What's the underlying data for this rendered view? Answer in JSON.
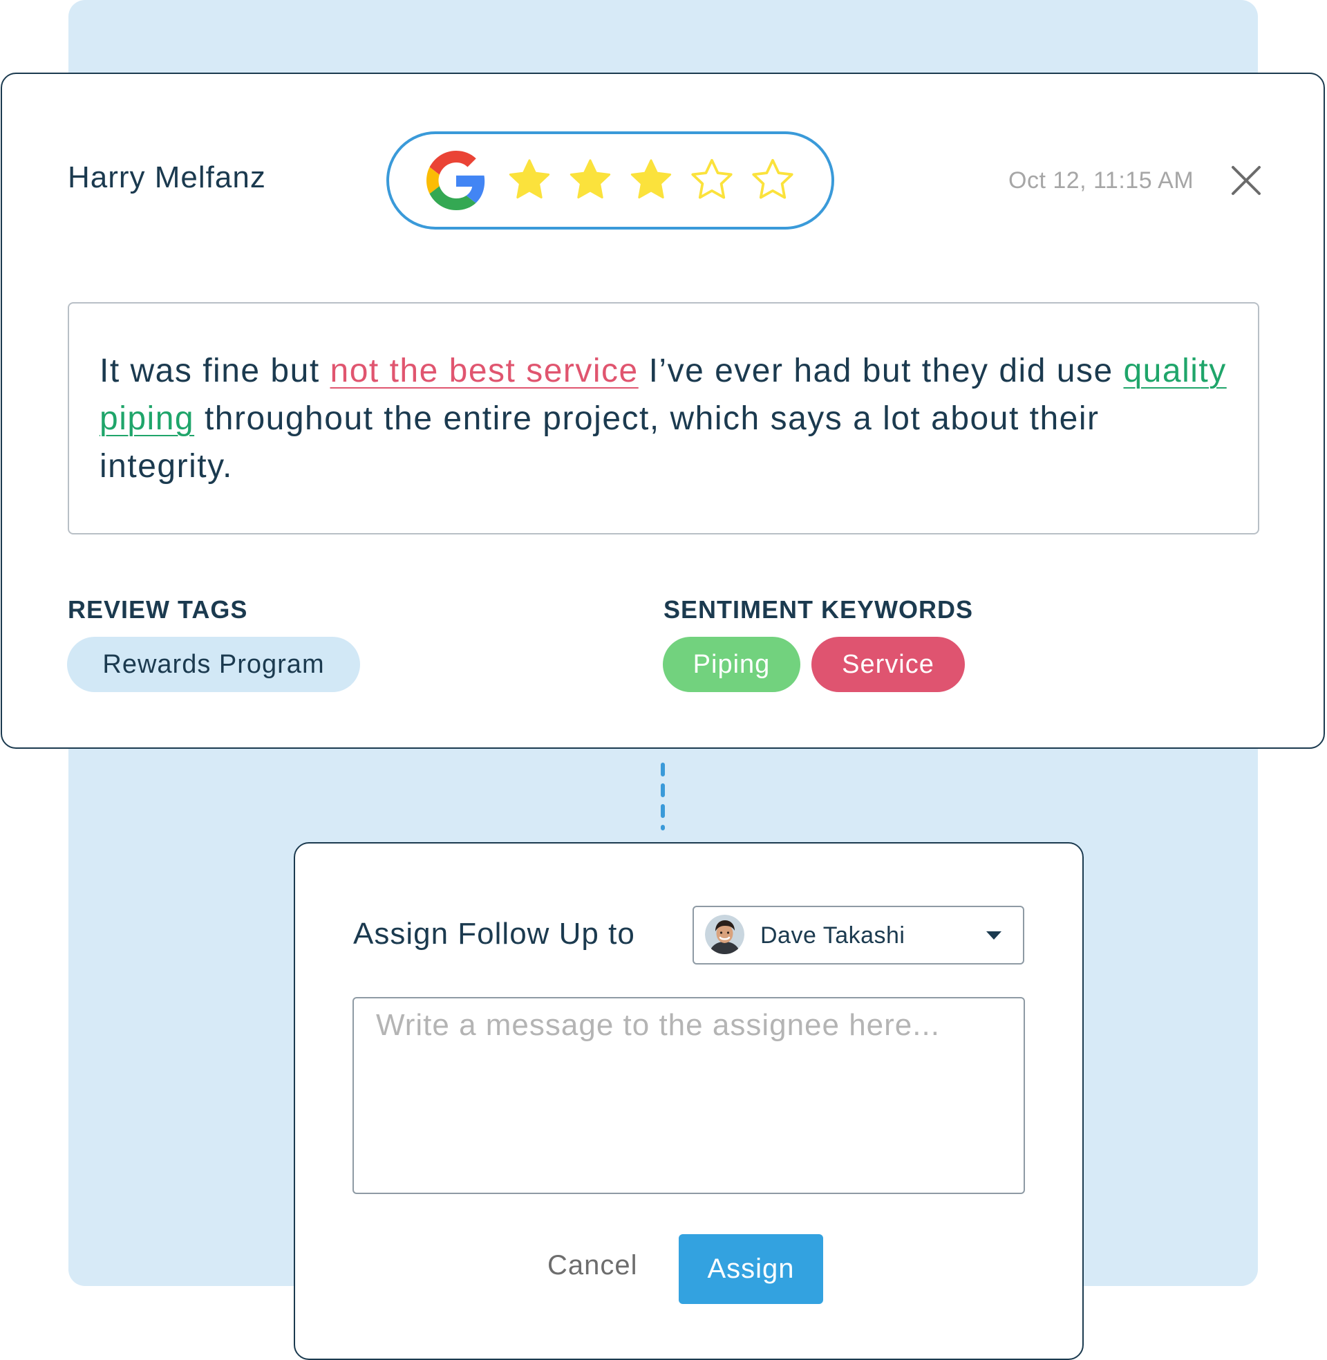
{
  "review": {
    "reviewer_name": "Harry Melfanz",
    "source_icon": "google-g-icon",
    "rating": 3,
    "rating_max": 5,
    "timestamp": "Oct 12, 11:15 AM",
    "close_icon": "close-icon",
    "text_parts": {
      "before_negative": "It was fine but ",
      "negative_phrase": "not the best service",
      "middle": " I’ve ever had but they did use ",
      "positive_phrase": "quality piping",
      "after_positive": " throughout the entire project, which says a lot about their integrity."
    },
    "tags_label": "REVIEW TAGS",
    "tags": [
      "Rewards Program"
    ],
    "sentiment_label": "SENTIMENT KEYWORDS",
    "sentiment_keywords": [
      {
        "label": "Piping",
        "sentiment": "positive"
      },
      {
        "label": "Service",
        "sentiment": "negative"
      }
    ]
  },
  "assign": {
    "label": "Assign Follow Up to",
    "assignee": "Dave Takashi",
    "assignee_avatar": "avatar-photo",
    "dropdown_icon": "chevron-down-icon",
    "message_placeholder": "Write a message to the assignee here...",
    "cancel_label": "Cancel",
    "assign_label": "Assign"
  },
  "colors": {
    "background_panel": "#d7eaf7",
    "dark_text": "#1b3a4f",
    "rating_border": "#3a9ad9",
    "star_fill": "#fbe23c",
    "negative": "#df5470",
    "positive_text": "#1fa56a",
    "positive_chip": "#72d27e",
    "tag_chip": "#d2e8f6",
    "primary_button": "#33a2e0"
  }
}
